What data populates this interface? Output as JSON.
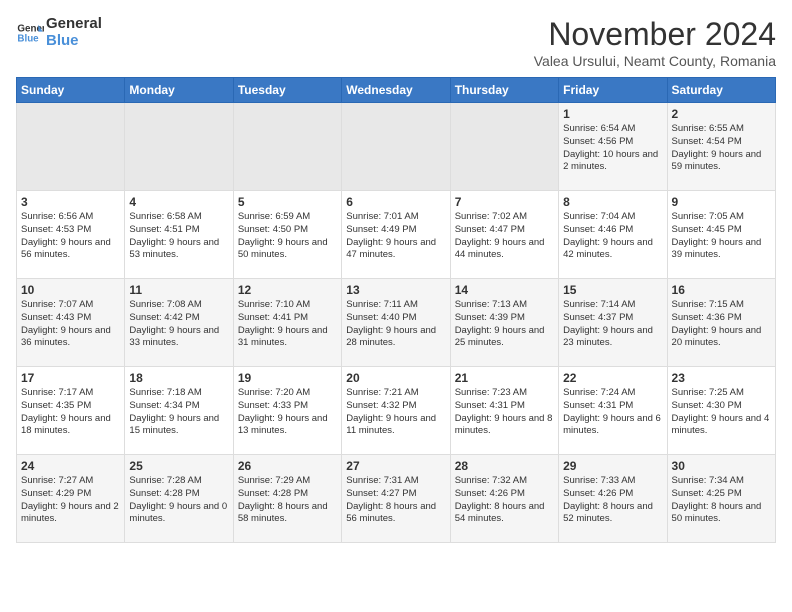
{
  "header": {
    "logo_line1": "General",
    "logo_line2": "Blue",
    "month_year": "November 2024",
    "location": "Valea Ursului, Neamt County, Romania"
  },
  "weekdays": [
    "Sunday",
    "Monday",
    "Tuesday",
    "Wednesday",
    "Thursday",
    "Friday",
    "Saturday"
  ],
  "weeks": [
    [
      {
        "day": "",
        "info": ""
      },
      {
        "day": "",
        "info": ""
      },
      {
        "day": "",
        "info": ""
      },
      {
        "day": "",
        "info": ""
      },
      {
        "day": "",
        "info": ""
      },
      {
        "day": "1",
        "info": "Sunrise: 6:54 AM\nSunset: 4:56 PM\nDaylight: 10 hours and 2 minutes."
      },
      {
        "day": "2",
        "info": "Sunrise: 6:55 AM\nSunset: 4:54 PM\nDaylight: 9 hours and 59 minutes."
      }
    ],
    [
      {
        "day": "3",
        "info": "Sunrise: 6:56 AM\nSunset: 4:53 PM\nDaylight: 9 hours and 56 minutes."
      },
      {
        "day": "4",
        "info": "Sunrise: 6:58 AM\nSunset: 4:51 PM\nDaylight: 9 hours and 53 minutes."
      },
      {
        "day": "5",
        "info": "Sunrise: 6:59 AM\nSunset: 4:50 PM\nDaylight: 9 hours and 50 minutes."
      },
      {
        "day": "6",
        "info": "Sunrise: 7:01 AM\nSunset: 4:49 PM\nDaylight: 9 hours and 47 minutes."
      },
      {
        "day": "7",
        "info": "Sunrise: 7:02 AM\nSunset: 4:47 PM\nDaylight: 9 hours and 44 minutes."
      },
      {
        "day": "8",
        "info": "Sunrise: 7:04 AM\nSunset: 4:46 PM\nDaylight: 9 hours and 42 minutes."
      },
      {
        "day": "9",
        "info": "Sunrise: 7:05 AM\nSunset: 4:45 PM\nDaylight: 9 hours and 39 minutes."
      }
    ],
    [
      {
        "day": "10",
        "info": "Sunrise: 7:07 AM\nSunset: 4:43 PM\nDaylight: 9 hours and 36 minutes."
      },
      {
        "day": "11",
        "info": "Sunrise: 7:08 AM\nSunset: 4:42 PM\nDaylight: 9 hours and 33 minutes."
      },
      {
        "day": "12",
        "info": "Sunrise: 7:10 AM\nSunset: 4:41 PM\nDaylight: 9 hours and 31 minutes."
      },
      {
        "day": "13",
        "info": "Sunrise: 7:11 AM\nSunset: 4:40 PM\nDaylight: 9 hours and 28 minutes."
      },
      {
        "day": "14",
        "info": "Sunrise: 7:13 AM\nSunset: 4:39 PM\nDaylight: 9 hours and 25 minutes."
      },
      {
        "day": "15",
        "info": "Sunrise: 7:14 AM\nSunset: 4:37 PM\nDaylight: 9 hours and 23 minutes."
      },
      {
        "day": "16",
        "info": "Sunrise: 7:15 AM\nSunset: 4:36 PM\nDaylight: 9 hours and 20 minutes."
      }
    ],
    [
      {
        "day": "17",
        "info": "Sunrise: 7:17 AM\nSunset: 4:35 PM\nDaylight: 9 hours and 18 minutes."
      },
      {
        "day": "18",
        "info": "Sunrise: 7:18 AM\nSunset: 4:34 PM\nDaylight: 9 hours and 15 minutes."
      },
      {
        "day": "19",
        "info": "Sunrise: 7:20 AM\nSunset: 4:33 PM\nDaylight: 9 hours and 13 minutes."
      },
      {
        "day": "20",
        "info": "Sunrise: 7:21 AM\nSunset: 4:32 PM\nDaylight: 9 hours and 11 minutes."
      },
      {
        "day": "21",
        "info": "Sunrise: 7:23 AM\nSunset: 4:31 PM\nDaylight: 9 hours and 8 minutes."
      },
      {
        "day": "22",
        "info": "Sunrise: 7:24 AM\nSunset: 4:31 PM\nDaylight: 9 hours and 6 minutes."
      },
      {
        "day": "23",
        "info": "Sunrise: 7:25 AM\nSunset: 4:30 PM\nDaylight: 9 hours and 4 minutes."
      }
    ],
    [
      {
        "day": "24",
        "info": "Sunrise: 7:27 AM\nSunset: 4:29 PM\nDaylight: 9 hours and 2 minutes."
      },
      {
        "day": "25",
        "info": "Sunrise: 7:28 AM\nSunset: 4:28 PM\nDaylight: 9 hours and 0 minutes."
      },
      {
        "day": "26",
        "info": "Sunrise: 7:29 AM\nSunset: 4:28 PM\nDaylight: 8 hours and 58 minutes."
      },
      {
        "day": "27",
        "info": "Sunrise: 7:31 AM\nSunset: 4:27 PM\nDaylight: 8 hours and 56 minutes."
      },
      {
        "day": "28",
        "info": "Sunrise: 7:32 AM\nSunset: 4:26 PM\nDaylight: 8 hours and 54 minutes."
      },
      {
        "day": "29",
        "info": "Sunrise: 7:33 AM\nSunset: 4:26 PM\nDaylight: 8 hours and 52 minutes."
      },
      {
        "day": "30",
        "info": "Sunrise: 7:34 AM\nSunset: 4:25 PM\nDaylight: 8 hours and 50 minutes."
      }
    ]
  ]
}
